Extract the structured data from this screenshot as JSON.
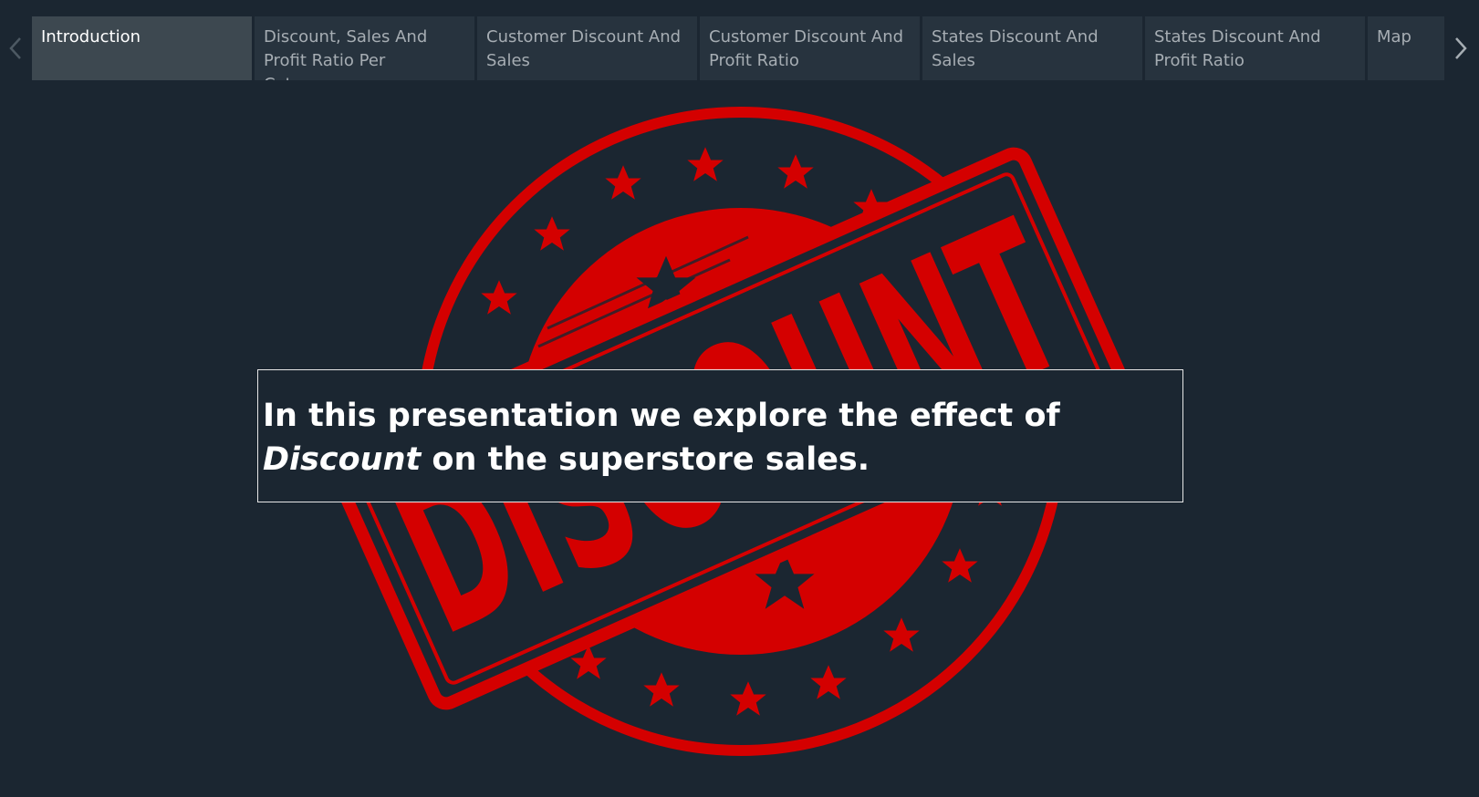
{
  "story": {
    "tabs": [
      {
        "label": "Introduction",
        "active": true
      },
      {
        "label": "Discount, Sales And Profit Ratio Per Category",
        "active": false
      },
      {
        "label": "Customer Discount And Sales",
        "active": false
      },
      {
        "label": "Customer Discount And Profit Ratio",
        "active": false
      },
      {
        "label": "States Discount And Sales",
        "active": false
      },
      {
        "label": "States Discount And Profit Ratio",
        "active": false
      },
      {
        "label": "Map",
        "active": false
      }
    ],
    "prev_icon": "chevron-left-icon",
    "next_icon": "chevron-right-icon"
  },
  "stamp": {
    "text": "DISCOUNT",
    "color": "#d40000"
  },
  "caption": {
    "before": "In this presentation we explore the effect of ",
    "emphasis": "Discount",
    "after": " on the superstore sales."
  },
  "colors": {
    "background": "#1b2631",
    "tab": "#27333e",
    "tab_active": "#3d4850",
    "accent": "#d40000"
  }
}
